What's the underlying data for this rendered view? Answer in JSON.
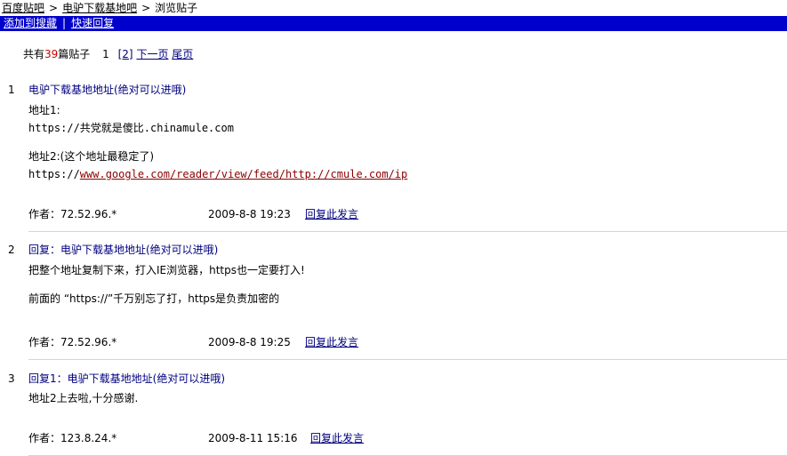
{
  "breadcrumb": {
    "items": [
      "百度贴吧",
      "电驴下载基地吧",
      "浏览贴子"
    ],
    "separator": ">"
  },
  "toolbar": {
    "add_bookmark": "添加到搜藏",
    "quick_reply": "快速回复",
    "pipe": "|"
  },
  "pager": {
    "prefix": "共有",
    "count": "39",
    "suffix": "篇贴子",
    "current": "1",
    "page2": "[2]",
    "next": "下一页",
    "last": "尾页"
  },
  "posts": [
    {
      "num": "1",
      "title": "电驴下载基地地址(绝对可以进哦)",
      "lines": [
        "地址1:",
        "https://共党就是傻比.chinamule.com",
        "",
        "地址2:(这个地址最稳定了)"
      ],
      "link_prefix": "https://",
      "link_text": "www.google.com/reader/view/feed/http://cmule.com/ip",
      "author": "作者：72.52.96.*",
      "date": "2009-8-8 19:23",
      "reply": "回复此发言"
    },
    {
      "num": "2",
      "title": "回复：电驴下载基地地址(绝对可以进哦)",
      "lines": [
        "把整个地址复制下来，打入IE浏览器，https也一定要打入!",
        "",
        "前面的 “https://”千万别忘了打，https是负责加密的"
      ],
      "author": "作者：72.52.96.*",
      "date": "2009-8-8 19:25",
      "reply": "回复此发言"
    },
    {
      "num": "3",
      "title": "回复1：电驴下载基地地址(绝对可以进哦)",
      "lines": [
        "地址2上去啦,十分感谢."
      ],
      "author": "作者：123.8.24.*",
      "date": "2009-8-11 15:16",
      "reply": "回复此发言"
    }
  ]
}
